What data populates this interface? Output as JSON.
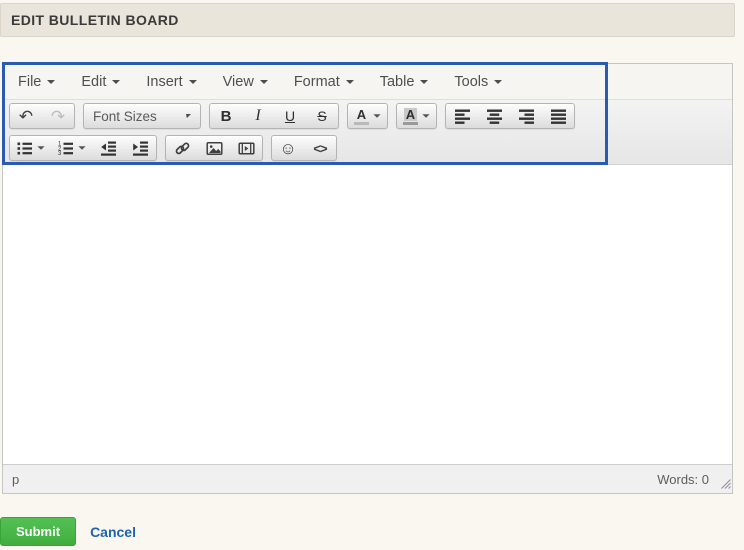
{
  "header": {
    "title": "EDIT BULLETIN BOARD"
  },
  "editor": {
    "menubar": {
      "items": [
        "File",
        "Edit",
        "Insert",
        "View",
        "Format",
        "Table",
        "Tools"
      ]
    },
    "toolbar": {
      "font_sizes_label": "Font Sizes",
      "bold_label": "B",
      "italic_label": "I",
      "underline_label": "U",
      "strikethrough_label": "S",
      "forecolor_label": "A",
      "backcolor_label": "A",
      "code_label": "<>",
      "icons": {
        "undo": "↶",
        "redo": "↷",
        "emoticon": "☺",
        "align_left": "svg-bars-left",
        "align_center": "svg-bars-center",
        "align_right": "svg-bars-right",
        "align_justify": "svg-bars-justify",
        "bullet_list": "svg-dot-bars",
        "numbered_list": "svg-number-bars",
        "outdent": "svg-left-arrow-bars",
        "indent": "svg-right-arrow-bars",
        "link": "svg-chain",
        "image": "svg-picture",
        "media": "svg-filmstrip-play",
        "dropdown_caret": "css-triangle-down",
        "resize_grip": "svg-diagonal-grip"
      }
    },
    "content": {
      "text": ""
    },
    "statusbar": {
      "element_path": "p",
      "word_count": "Words: 0"
    }
  },
  "actions": {
    "submit_label": "Submit",
    "cancel_label": "Cancel"
  },
  "colors": {
    "highlight_border": "#2a5bb0",
    "submit_green": "#47b347",
    "cancel_link": "#1e64ad",
    "header_bg": "#e9e5da"
  }
}
